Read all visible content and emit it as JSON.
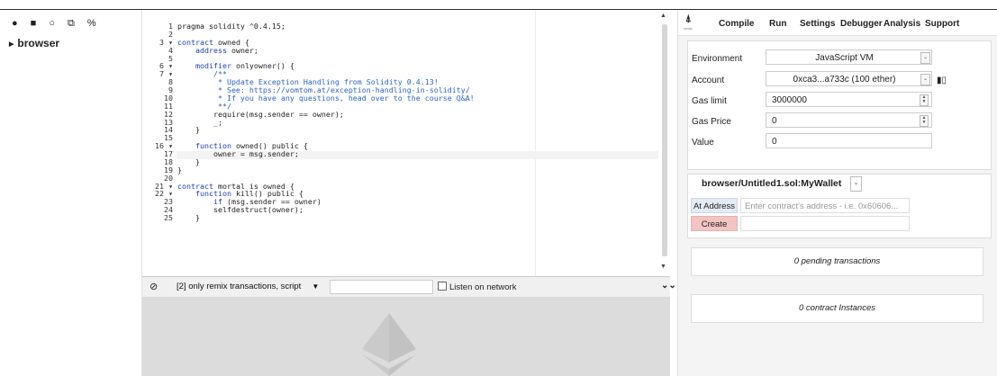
{
  "left_panel": {
    "toolbar_icons": [
      "add-file-icon",
      "folder-open-icon",
      "github-icon",
      "copy-files-icon",
      "link-icon"
    ],
    "tree_root": "browser"
  },
  "editor": {
    "line_numbers": [
      "1",
      "2",
      "3",
      "4",
      "5",
      "6",
      "7",
      "8",
      "9",
      "10",
      "11",
      "12",
      "13",
      "14",
      "15",
      "16",
      "17",
      "18",
      "19",
      "20",
      "21",
      "22",
      "23",
      "24",
      "25"
    ],
    "code_lines": [
      "pragma solidity ^0.4.15;",
      "",
      "contract owned {",
      "    address owner;",
      "",
      "    modifier onlyowner() {",
      "        /**",
      "         * Update Exception Handling from Solidity 0.4.13!",
      "         * See: https://vomtom.at/exception-handling-in-solidity/",
      "         * If you have any questions, head over to the course Q&A!",
      "         **/",
      "        require(msg.sender == owner);",
      "        _;",
      "    }",
      "",
      "    function owned() public {",
      "        owner = msg.sender;",
      "    }",
      "}",
      "",
      "contract mortal is owned {",
      "    function kill() public {",
      "        if (msg.sender == owner)",
      "        selfdestruct(owner);",
      "    }"
    ]
  },
  "terminal": {
    "filter_label": "[2] only remix transactions, script",
    "search_value": "",
    "listen_label": "Listen on network"
  },
  "right_panel": {
    "tabs": [
      "Compile",
      "Run",
      "Settings",
      "Debugger",
      "Analysis",
      "Support"
    ],
    "active_tab": "Run",
    "environment": {
      "label": "Environment",
      "value": "JavaScript VM"
    },
    "account": {
      "label": "Account",
      "value": "0xca3...a733c (100 ether)"
    },
    "gas_limit": {
      "label": "Gas limit",
      "value": "3000000"
    },
    "gas_price": {
      "label": "Gas Price",
      "value": "0"
    },
    "value": {
      "label": "Value",
      "value": "0"
    },
    "contract_select": "browser/Untitled1.sol:MyWallet",
    "at_address_button": "At Address",
    "at_address_placeholder": "Enter contract's address - i.e. 0x60606...",
    "create_button": "Create",
    "pending_transactions": "0 pending transactions",
    "contract_instances": "0 contract Instances"
  }
}
